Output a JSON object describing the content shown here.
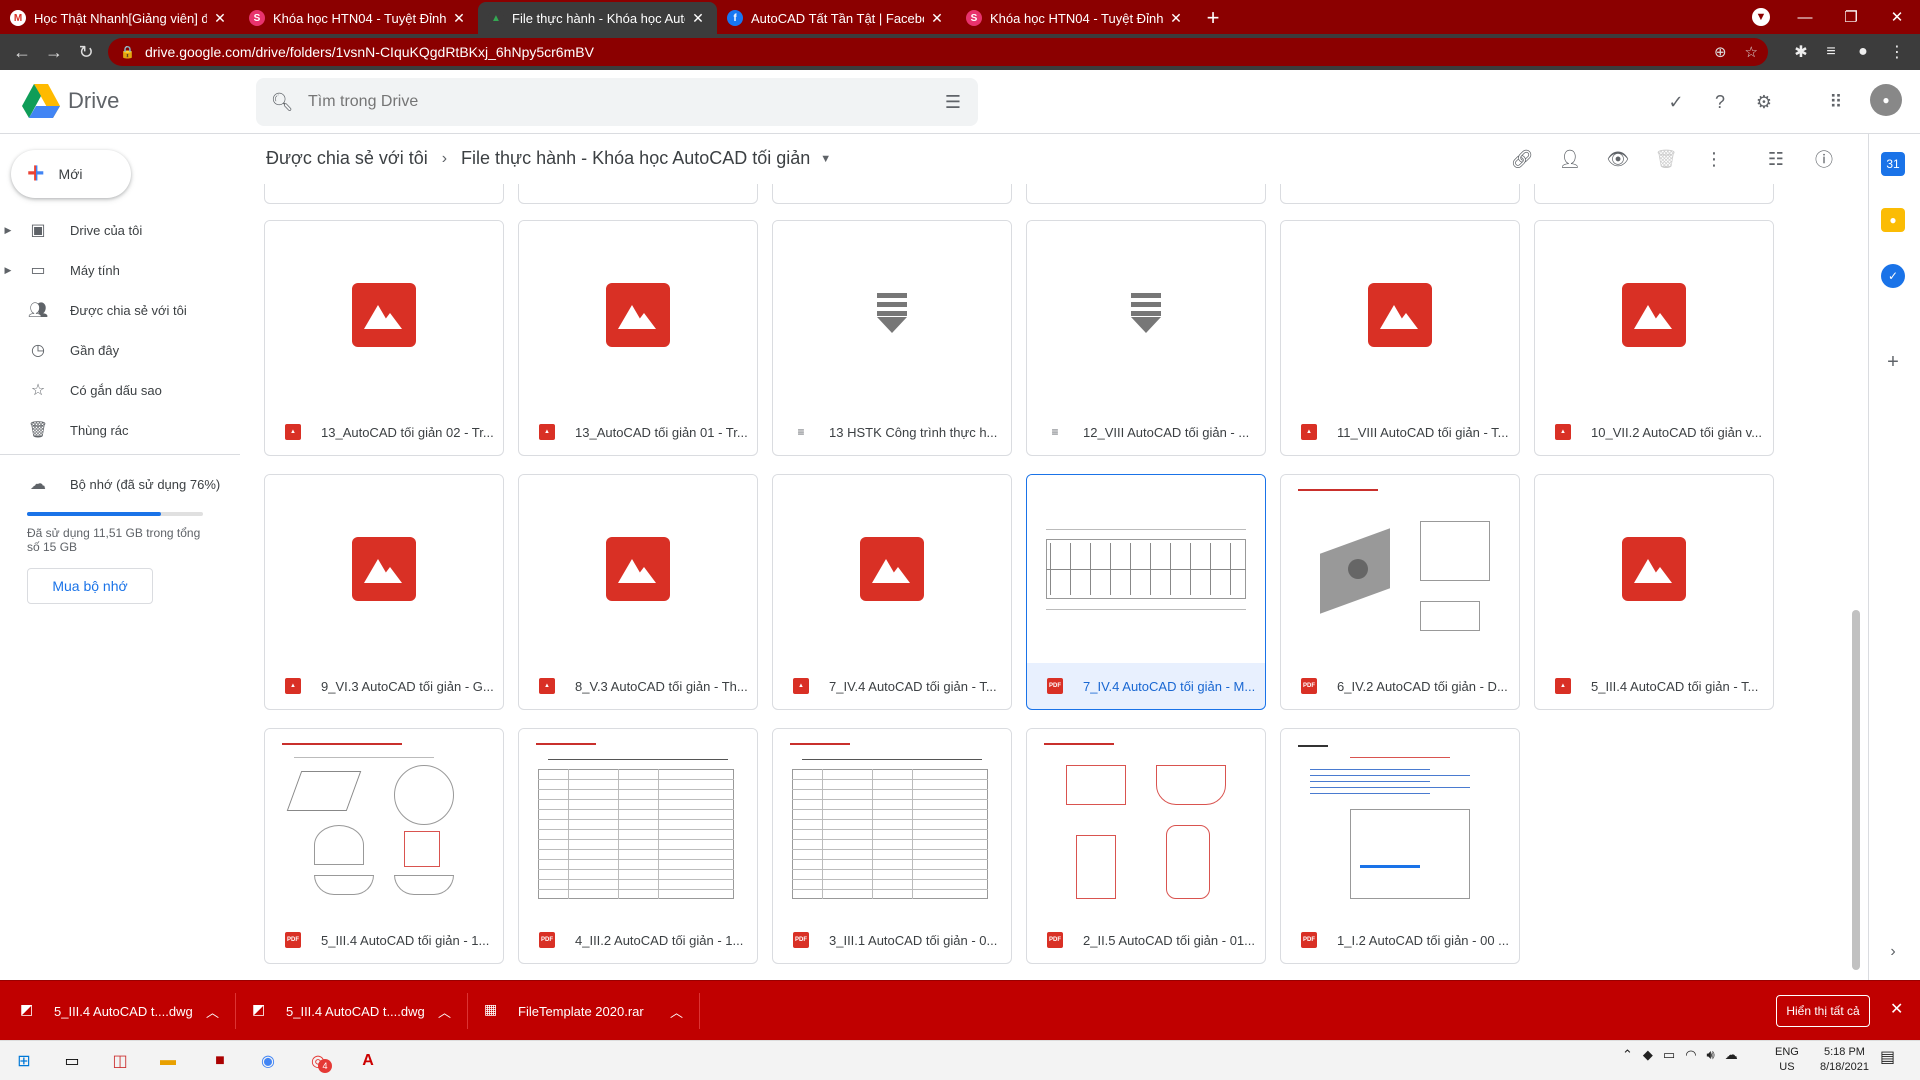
{
  "browser": {
    "tabs": [
      {
        "title": "Học Thật Nhanh[Giảng viên] đã",
        "favicon": "M",
        "favicon_color": "#ffffff",
        "favicon_fg": "#d93025"
      },
      {
        "title": "Khóa học HTN04 - Tuyệt Đỉnh Au",
        "favicon": "S",
        "favicon_color": "#e8336d",
        "favicon_fg": "#ffffff"
      },
      {
        "title": "File thực hành - Khóa học AutoC",
        "favicon": "▲",
        "favicon_color": "#3c3c3c",
        "favicon_fg": "#34a853"
      },
      {
        "title": "AutoCAD Tất Tần Tật | Facebook",
        "favicon": "f",
        "favicon_color": "#1877f2",
        "favicon_fg": "#ffffff"
      },
      {
        "title": "Khóa học HTN04 - Tuyệt Đỉnh Au",
        "favicon": "S",
        "favicon_color": "#e8336d",
        "favicon_fg": "#ffffff"
      }
    ],
    "url": "drive.google.com/drive/folders/1vsnN-CIquKQgdRtBKxj_6hNpy5cr6mBV"
  },
  "header": {
    "brand": "Drive",
    "search_placeholder": "Tìm trong Drive"
  },
  "sidebar": {
    "new_label": "Mới",
    "items": [
      {
        "label": "Drive của tôi",
        "icon": "drive-icon",
        "caret": true
      },
      {
        "label": "Máy tính",
        "icon": "computer-icon",
        "caret": true
      },
      {
        "label": "Được chia sẻ với tôi",
        "icon": "shared-icon",
        "caret": false
      },
      {
        "label": "Gần đây",
        "icon": "clock-icon",
        "caret": false
      },
      {
        "label": "Có gắn dấu sao",
        "icon": "star-icon",
        "caret": false
      },
      {
        "label": "Thùng rác",
        "icon": "trash-icon",
        "caret": false
      }
    ],
    "storage_label": "Bộ nhớ (đã sử dụng 76%)",
    "storage_used_fraction": 0.76,
    "storage_detail": "Đã sử dụng 11,51 GB trong tổng số 15 GB",
    "buy_label": "Mua bộ nhớ"
  },
  "toolbar": {
    "crumb_parent": "Được chia sẻ với tôi",
    "crumb_current": "File thực hành - Khóa học AutoCAD tối giản"
  },
  "files": [
    {
      "name": "13_AutoCAD tối giản 02 - Tr...",
      "type": "image"
    },
    {
      "name": "13_AutoCAD tối giản 01 - Tr...",
      "type": "image"
    },
    {
      "name": "13 HSTK Công trình thực h...",
      "type": "download"
    },
    {
      "name": "12_VIII AutoCAD tối giản - ...",
      "type": "download"
    },
    {
      "name": "11_VIII AutoCAD tối giản - T...",
      "type": "image"
    },
    {
      "name": "10_VII.2 AutoCAD tối giản v...",
      "type": "image"
    },
    {
      "name": "9_VI.3 AutoCAD tối giản - G...",
      "type": "image"
    },
    {
      "name": "8_V.3 AutoCAD tối giản - Th...",
      "type": "image"
    },
    {
      "name": "7_IV.4 AutoCAD tối giản - T...",
      "type": "image"
    },
    {
      "name": "7_IV.4 AutoCAD tối giản - M...",
      "type": "pdf",
      "selected": true,
      "preview": "plan"
    },
    {
      "name": "6_IV.2 AutoCAD tối giản - D...",
      "type": "pdf",
      "preview": "3d"
    },
    {
      "name": "5_III.4 AutoCAD tối giản - T...",
      "type": "image"
    },
    {
      "name": "5_III.4 AutoCAD tối giản - 1...",
      "type": "pdf",
      "preview": "sketch"
    },
    {
      "name": "4_III.2 AutoCAD tối giản - 1...",
      "type": "pdf",
      "preview": "table"
    },
    {
      "name": "3_III.1 AutoCAD tối giản - 0...",
      "type": "pdf",
      "preview": "table"
    },
    {
      "name": "2_II.5 AutoCAD tối giản - 01...",
      "type": "pdf",
      "preview": "shapes"
    },
    {
      "name": "1_I.2 AutoCAD tối giản - 00 ...",
      "type": "pdf",
      "preview": "doc"
    }
  ],
  "downloads": [
    {
      "name": "5_III.4 AutoCAD t....dwg"
    },
    {
      "name": "5_III.4 AutoCAD t....dwg"
    },
    {
      "name": "FileTemplate 2020.rar"
    }
  ],
  "download_show_all": "Hiển thị tất cả",
  "taskbar": {
    "lang_top": "ENG",
    "lang_bottom": "US",
    "time": "5:18 PM",
    "date": "8/18/2021",
    "chrome_badge": "4"
  },
  "colors": {
    "browser_frame": "#8b0000",
    "download_bar": "#c00000",
    "accent": "#1a73e8",
    "image_icon": "#d93025"
  }
}
